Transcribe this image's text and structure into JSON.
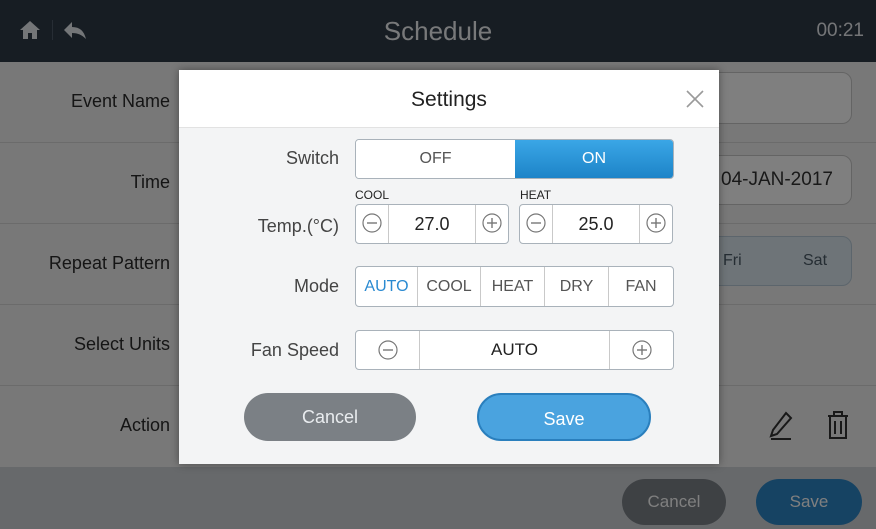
{
  "topbar": {
    "title": "Schedule",
    "clock": "00:21"
  },
  "background": {
    "rows": [
      {
        "label": "Event Name"
      },
      {
        "label": "Time",
        "date": "04-JAN-2017"
      },
      {
        "label": "Repeat Pattern",
        "days": [
          "Fri",
          "Sat"
        ]
      },
      {
        "label": "Select Units"
      },
      {
        "label": "Action"
      }
    ],
    "cancel_label": "Cancel",
    "save_label": "Save"
  },
  "modal": {
    "title": "Settings",
    "switch": {
      "label": "Switch",
      "off": "OFF",
      "on": "ON",
      "selected": "ON"
    },
    "temp": {
      "label": "Temp.(°C)",
      "cool": {
        "caption": "COOL",
        "value": "27.0"
      },
      "heat": {
        "caption": "HEAT",
        "value": "25.0"
      }
    },
    "mode": {
      "label": "Mode",
      "options": [
        "AUTO",
        "COOL",
        "HEAT",
        "DRY",
        "FAN"
      ],
      "selected": "AUTO"
    },
    "fan_speed": {
      "label": "Fan Speed",
      "value": "AUTO"
    },
    "cancel_label": "Cancel",
    "save_label": "Save"
  },
  "colors": {
    "accent": "#2a8ad1",
    "topbar": "#2e3a47",
    "cancel": "#7b8085"
  }
}
